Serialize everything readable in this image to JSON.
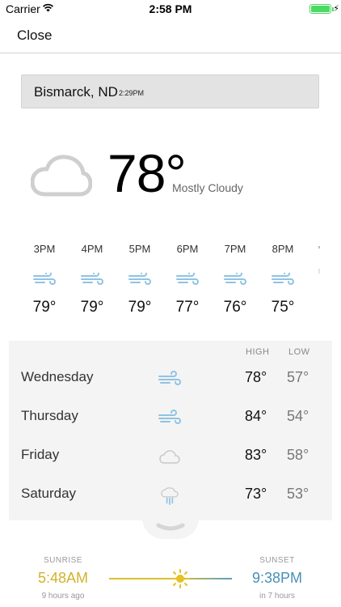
{
  "status_bar": {
    "carrier": "Carrier",
    "time": "2:58 PM"
  },
  "nav": {
    "close_label": "Close"
  },
  "location": {
    "name": "Bismarck, ND",
    "local_time": "2:29PM"
  },
  "current": {
    "temp": "78°",
    "condition": "Mostly Cloudy",
    "icon": "cloud-icon"
  },
  "hourly": [
    {
      "time": "3PM",
      "icon": "wind-icon",
      "temp": "79°"
    },
    {
      "time": "4PM",
      "icon": "wind-icon",
      "temp": "79°"
    },
    {
      "time": "5PM",
      "icon": "wind-icon",
      "temp": "79°"
    },
    {
      "time": "6PM",
      "icon": "wind-icon",
      "temp": "77°"
    },
    {
      "time": "7PM",
      "icon": "wind-icon",
      "temp": "76°"
    },
    {
      "time": "8PM",
      "icon": "wind-icon",
      "temp": "75°"
    }
  ],
  "daily_header": {
    "high": "HIGH",
    "low": "LOW"
  },
  "daily": [
    {
      "day": "Wednesday",
      "icon": "wind-icon",
      "high": "78°",
      "low": "57°"
    },
    {
      "day": "Thursday",
      "icon": "wind-icon",
      "high": "84°",
      "low": "54°"
    },
    {
      "day": "Friday",
      "icon": "cloud-icon",
      "high": "83°",
      "low": "58°"
    },
    {
      "day": "Saturday",
      "icon": "rain-icon",
      "high": "73°",
      "low": "53°"
    }
  ],
  "sun": {
    "sunrise_label": "SUNRISE",
    "sunrise_time": "5:48AM",
    "sunrise_relative": "9 hours ago",
    "sunset_label": "SUNSET",
    "sunset_time": "9:38PM",
    "sunset_relative": "in 7 hours"
  },
  "colors": {
    "sunrise": "#d4b12a",
    "sunset": "#4a8fb8",
    "wind_icon": "#8fc3e3",
    "battery": "#4cd964"
  }
}
